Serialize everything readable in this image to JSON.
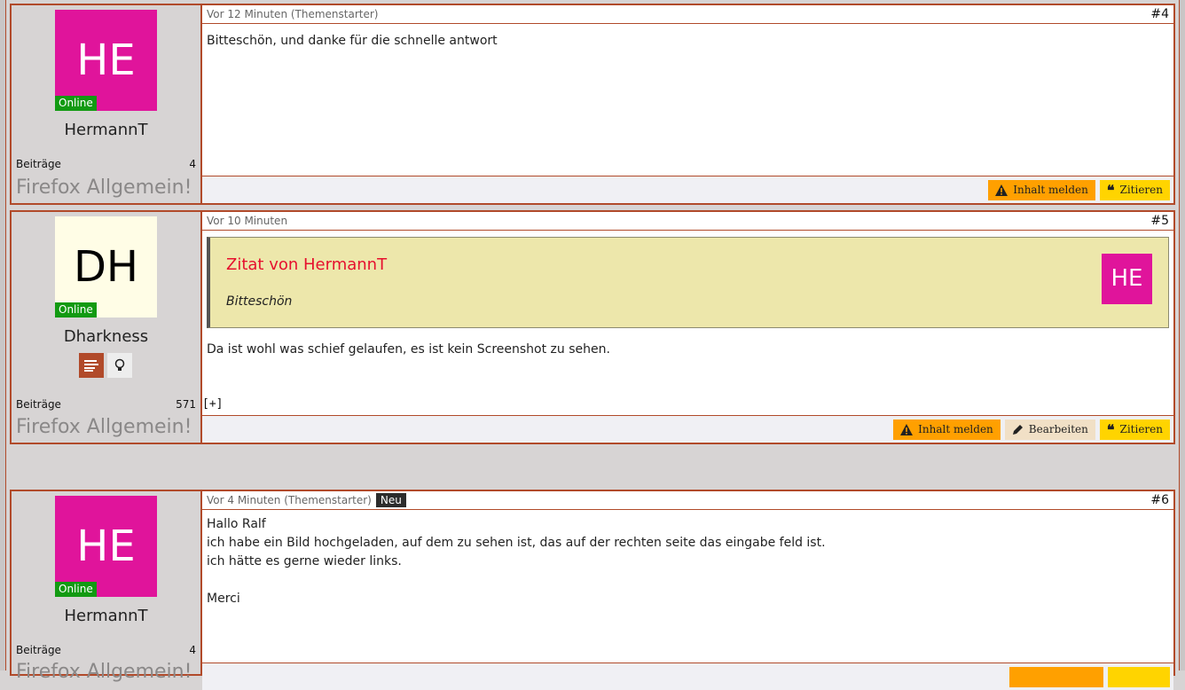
{
  "posts": [
    {
      "user": {
        "initials": "HE",
        "name": "HermannT",
        "status": "Online",
        "posts_label": "Beiträge",
        "posts_count": "4",
        "rank": "Firefox Allgemein!"
      },
      "meta": {
        "time": "Vor 12 Minuten (Themenstarter)",
        "number": "#4"
      },
      "text": "Bitteschön, und danke für die schnelle antwort",
      "buttons": {
        "report": "Inhalt melden",
        "quote": "Zitieren"
      }
    },
    {
      "user": {
        "initials": "DH",
        "name": "Dharkness",
        "status": "Online",
        "posts_label": "Beiträge",
        "posts_count": "571",
        "rank": "Firefox Allgemein!"
      },
      "meta": {
        "time": "Vor 10 Minuten",
        "number": "#5"
      },
      "quote": {
        "title": "Zitat von HermannT",
        "text": "Bitteschön",
        "avatar": "HE"
      },
      "text": "Da ist wohl was schief gelaufen, es ist kein Screenshot zu sehen.",
      "expand": "[+]",
      "buttons": {
        "report": "Inhalt melden",
        "edit": "Bearbeiten",
        "quote": "Zitieren"
      }
    },
    {
      "user": {
        "initials": "HE",
        "name": "HermannT",
        "status": "Online",
        "posts_label": "Beiträge",
        "posts_count": "4",
        "rank": "Firefox Allgemein!"
      },
      "meta": {
        "time": "Vor 4 Minuten (Themenstarter)",
        "badge": "Neu",
        "number": "#6"
      },
      "lines": [
        "Hallo Ralf",
        "ich habe ein Bild hochgeladen, auf dem zu sehen ist, das auf der rechten seite das eingabe feld ist.",
        "ich hätte es gerne wieder links.",
        "",
        "Merci"
      ]
    }
  ],
  "colors": {
    "accent": "#b14a2a",
    "avatar_pink": "#e0149b",
    "online": "#129a12",
    "report": "#ffa000",
    "quote": "#ffd400"
  }
}
